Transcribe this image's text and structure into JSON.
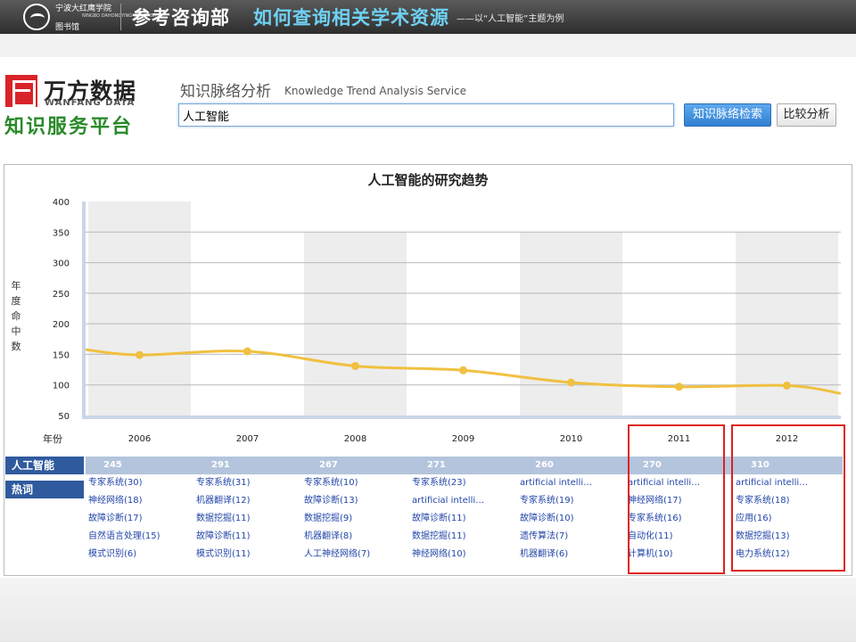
{
  "banner": {
    "school": "宁波大红鹰学院",
    "school_en": "NINGBO DAHONGYING UNIVERSITY",
    "library": "图书馆",
    "department": "参考咨询部",
    "topic": "如何查询相关学术资源",
    "subtitle": "——以“人工智能”主题为例"
  },
  "wanfang": {
    "name": "万方数据",
    "name_en": "WANFANG DATA",
    "platform": "知识服务平台"
  },
  "service": {
    "title": "知识脉络分析",
    "title_en": "Knowledge Trend Analysis Service"
  },
  "search": {
    "value": "人工智能",
    "search_button": "知识脉络检索",
    "compare_button": "比较分析"
  },
  "chart": {
    "title": "人工智能的研究趋势",
    "ylabel": "年度命中数",
    "xlabel": "年份",
    "line_color": "#f0c040"
  },
  "chart_data": {
    "type": "line",
    "title": "人工智能的研究趋势",
    "xlabel": "年份",
    "ylabel": "年度命中数",
    "x": [
      "2006",
      "2007",
      "2008",
      "2009",
      "2010",
      "2011",
      "2012"
    ],
    "yticks": [
      "400",
      "350",
      "300",
      "250",
      "200",
      "150",
      "100",
      "50"
    ],
    "ylim": [
      50,
      400
    ],
    "series": [
      {
        "name": "人工智能",
        "values": [
          149,
          155,
          131,
          124,
          104,
          97,
          99
        ]
      }
    ],
    "grid": true
  },
  "table": {
    "term_label": "人工智能",
    "hot_label": "热词",
    "counts": [
      "245",
      "291",
      "267",
      "271",
      "260",
      "270",
      "310"
    ],
    "hot_words": [
      [
        "专家系统(30)",
        "神经网络(18)",
        "故障诊断(17)",
        "自然语言处理(15)",
        "模式识别(6)"
      ],
      [
        "专家系统(31)",
        "机器翻译(12)",
        "数据挖掘(11)",
        "故障诊断(11)",
        "模式识别(11)"
      ],
      [
        "专家系统(10)",
        "故障诊断(13)",
        "数据挖掘(9)",
        "机器翻译(8)",
        "人工神经网络(7)"
      ],
      [
        "专家系统(23)",
        "artificial intelli…",
        "故障诊断(11)",
        "数据挖掘(11)",
        "神经网络(10)"
      ],
      [
        "artificial intelli…",
        "专家系统(19)",
        "故障诊断(10)",
        "遗传算法(7)",
        "机器翻译(6)"
      ],
      [
        "artificial intelli…",
        "神经网络(17)",
        "专家系统(16)",
        "自动化(11)",
        "计算机(10)"
      ],
      [
        "artificial intelli…",
        "专家系统(18)",
        "应用(16)",
        "数据挖掘(13)",
        "电力系统(12)"
      ]
    ]
  }
}
